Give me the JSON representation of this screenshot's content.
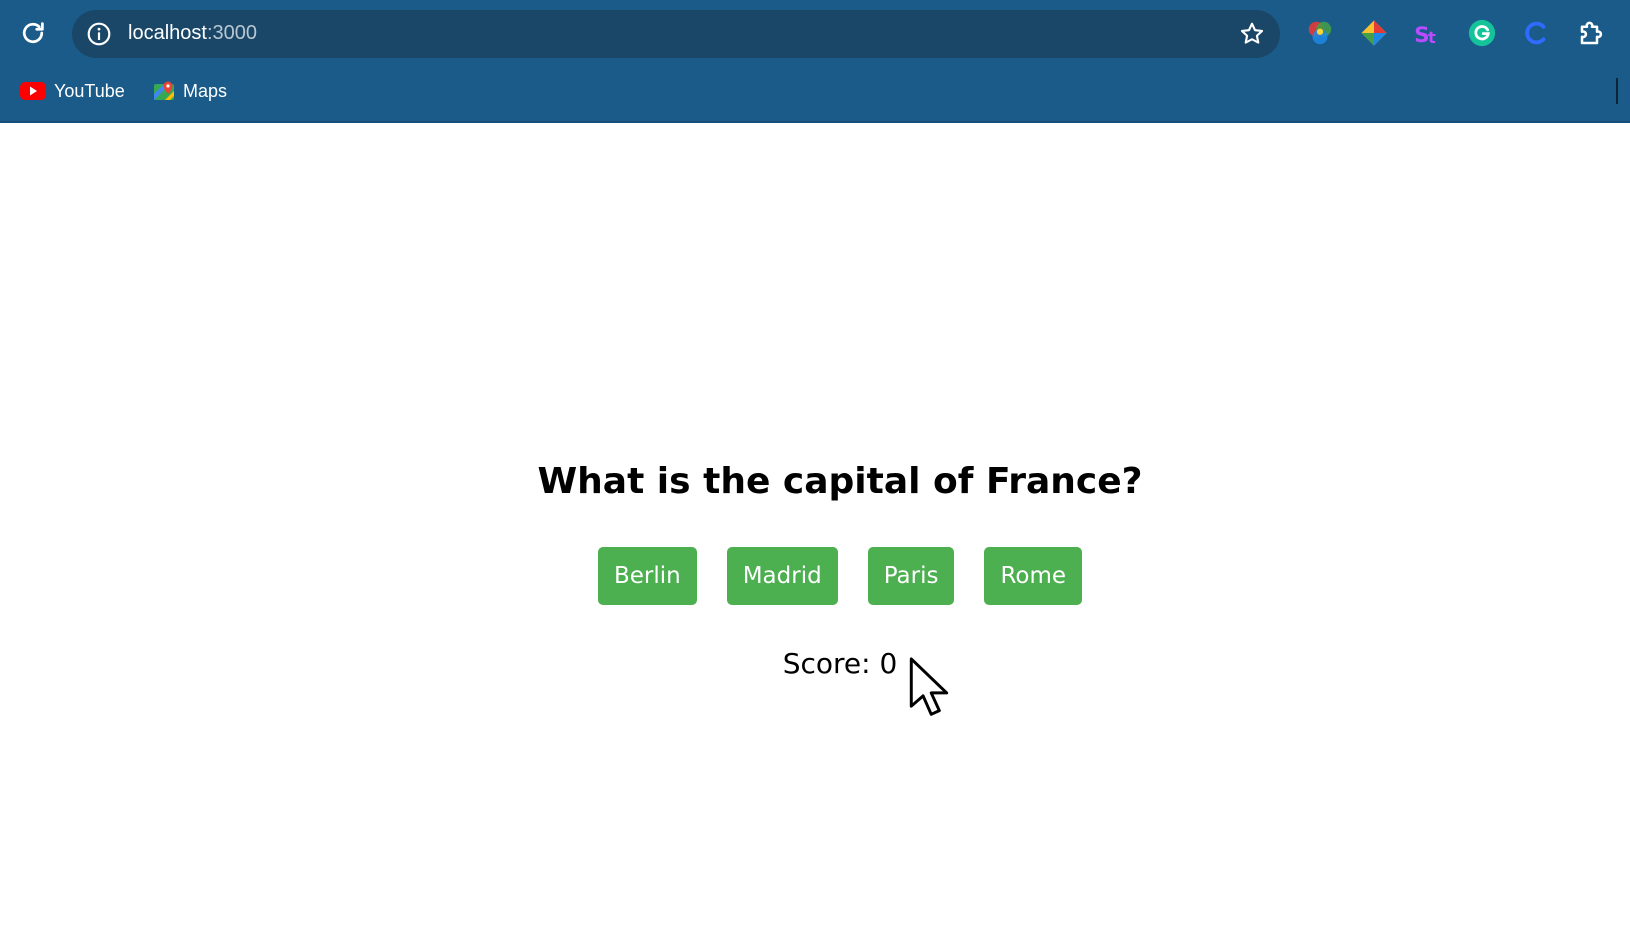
{
  "browser": {
    "url_host": "localhost",
    "url_port": ":3000",
    "bookmarks": [
      {
        "label": "YouTube",
        "icon": "youtube-icon"
      },
      {
        "label": "Maps",
        "icon": "maps-icon"
      }
    ],
    "extensions": [
      "color-wheel-icon",
      "diamond-extension-icon",
      "st-extension-icon",
      "grammarly-icon",
      "c-extension-icon",
      "puzzle-icon"
    ]
  },
  "quiz": {
    "question": "What is the capital of France?",
    "options": [
      "Berlin",
      "Madrid",
      "Paris",
      "Rome"
    ],
    "score_label": "Score:",
    "score_value": "0"
  },
  "colors": {
    "chrome_bg": "#1b5b8a",
    "omnibox_bg": "#1a4768",
    "button_green": "#4caf50"
  }
}
